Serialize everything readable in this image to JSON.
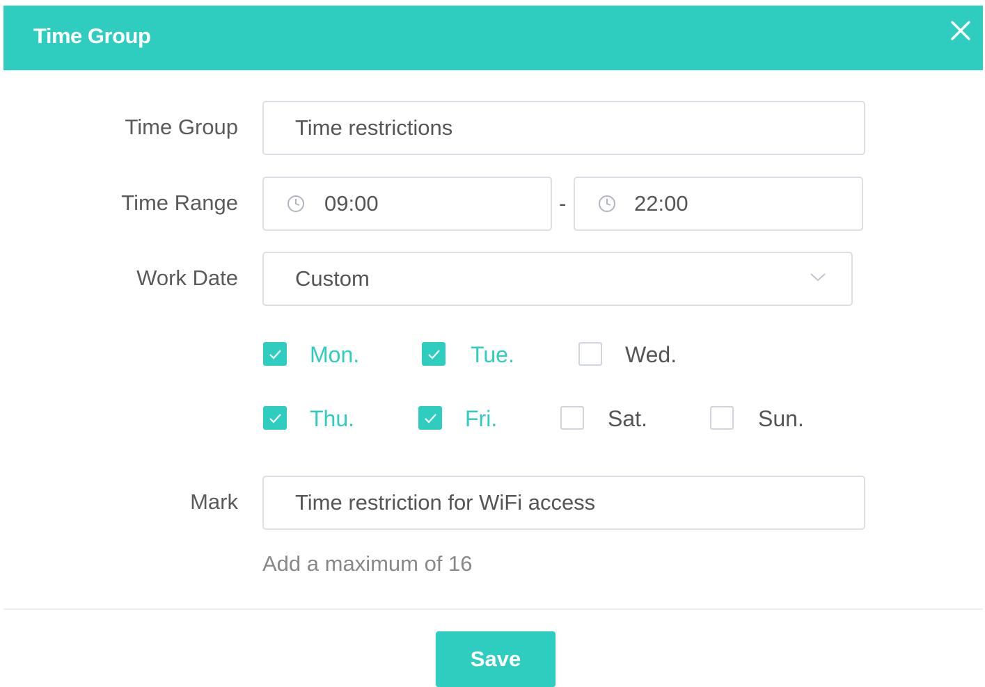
{
  "dialog": {
    "title": "Time Group",
    "close_icon": "close-icon"
  },
  "form": {
    "time_group": {
      "label": "Time Group",
      "value": "Time restrictions"
    },
    "time_range": {
      "label": "Time Range",
      "start": "09:00",
      "separator": "-",
      "end": "22:00",
      "icon": "clock-icon"
    },
    "work_date": {
      "label": "Work Date",
      "value": "Custom",
      "icon": "chevron-down-icon"
    },
    "days": [
      {
        "label": "Mon.",
        "checked": true
      },
      {
        "label": "Tue.",
        "checked": true
      },
      {
        "label": "Wed.",
        "checked": false
      },
      {
        "label": "Thu.",
        "checked": true
      },
      {
        "label": "Fri.",
        "checked": true
      },
      {
        "label": "Sat.",
        "checked": false
      },
      {
        "label": "Sun.",
        "checked": false
      }
    ],
    "mark": {
      "label": "Mark",
      "value": "Time restriction for WiFi access"
    },
    "hint": "Add a maximum of 16"
  },
  "footer": {
    "save_label": "Save"
  },
  "colors": {
    "accent": "#2ecdc0",
    "border": "#dcdfe6",
    "text": "#555555",
    "hint": "#888888"
  }
}
